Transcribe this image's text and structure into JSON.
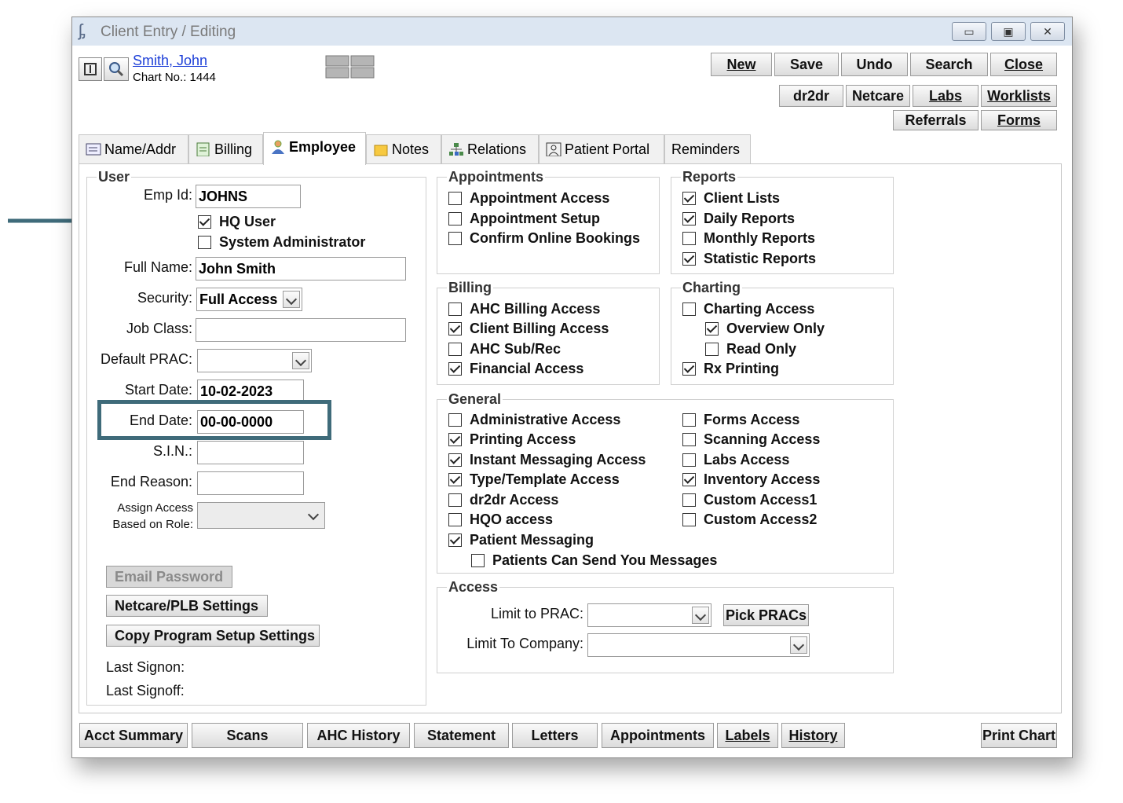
{
  "window": {
    "title": "Client Entry / Editing",
    "buttons": [
      "▭",
      "▣",
      "✕"
    ]
  },
  "patient": {
    "name": "Smith, John",
    "chart_label": "Chart No.: 1444"
  },
  "toolbar": {
    "row1": [
      "New",
      "Save",
      "Undo",
      "Search",
      "Close"
    ],
    "row2": [
      "dr2dr",
      "Netcare",
      "Labs",
      "Worklists"
    ],
    "row3": [
      "Referrals",
      "Forms"
    ]
  },
  "tabs": [
    "Name/Addr",
    "Billing",
    "Employee",
    "Notes",
    "Relations",
    "Patient Portal",
    "Reminders"
  ],
  "user": {
    "legend": "User",
    "emp_id_label": "Emp Id:",
    "emp_id": "JOHNS",
    "hq_user": "HQ User",
    "sys_admin": "System Administrator",
    "full_name_label": "Full Name:",
    "full_name": "John Smith",
    "security_label": "Security:",
    "security": "Full Access",
    "job_class_label": "Job Class:",
    "job_class": "",
    "default_prac_label": "Default PRAC:",
    "default_prac": "",
    "start_date_label": "Start Date:",
    "start_date": "10-02-2023",
    "end_date_label": "End Date:",
    "end_date": "00-00-0000",
    "sin_label": "S.I.N.:",
    "sin": "",
    "end_reason_label": "End Reason:",
    "end_reason": "",
    "assign_label_1": "Assign Access",
    "assign_label_2": "Based on Role:",
    "email_password": "Email Password",
    "netcare_settings": "Netcare/PLB Settings",
    "copy_settings": "Copy Program Setup Settings",
    "last_signon": "Last Signon:",
    "last_signoff": "Last Signoff:"
  },
  "appointments": {
    "legend": "Appointments",
    "items": [
      "Appointment Access",
      "Appointment Setup",
      "Confirm Online Bookings"
    ]
  },
  "reports": {
    "legend": "Reports",
    "items": [
      "Client Lists",
      "Daily Reports",
      "Monthly Reports",
      "Statistic Reports"
    ]
  },
  "billing": {
    "legend": "Billing",
    "items": [
      "AHC Billing Access",
      "Client Billing Access",
      "AHC Sub/Rec",
      "Financial Access"
    ]
  },
  "charting": {
    "legend": "Charting",
    "items": [
      "Charting Access",
      "Overview Only",
      "Read Only",
      "Rx Printing"
    ]
  },
  "general": {
    "legend": "General",
    "left": [
      "Administrative Access",
      "Printing Access",
      "Instant Messaging Access",
      "Type/Template Access",
      "dr2dr Access",
      "HQO access",
      "Patient Messaging",
      "Patients Can Send You Messages"
    ],
    "right": [
      "Forms Access",
      "Scanning Access",
      "Labs Access",
      "Inventory Access",
      "Custom Access1",
      "Custom Access2"
    ]
  },
  "access": {
    "legend": "Access",
    "limit_prac_label": "Limit to PRAC:",
    "pick_pracs": "Pick PRACs",
    "limit_company_label": "Limit To Company:"
  },
  "bottom": [
    "Acct Summary",
    "Scans",
    "AHC History",
    "Statement",
    "Letters",
    "Appointments",
    "Labels",
    "History",
    "Print Chart"
  ],
  "colors": {
    "annotation": "#3f6b7a",
    "title_bar": "#dce6f2",
    "link": "#1d3fd8"
  }
}
